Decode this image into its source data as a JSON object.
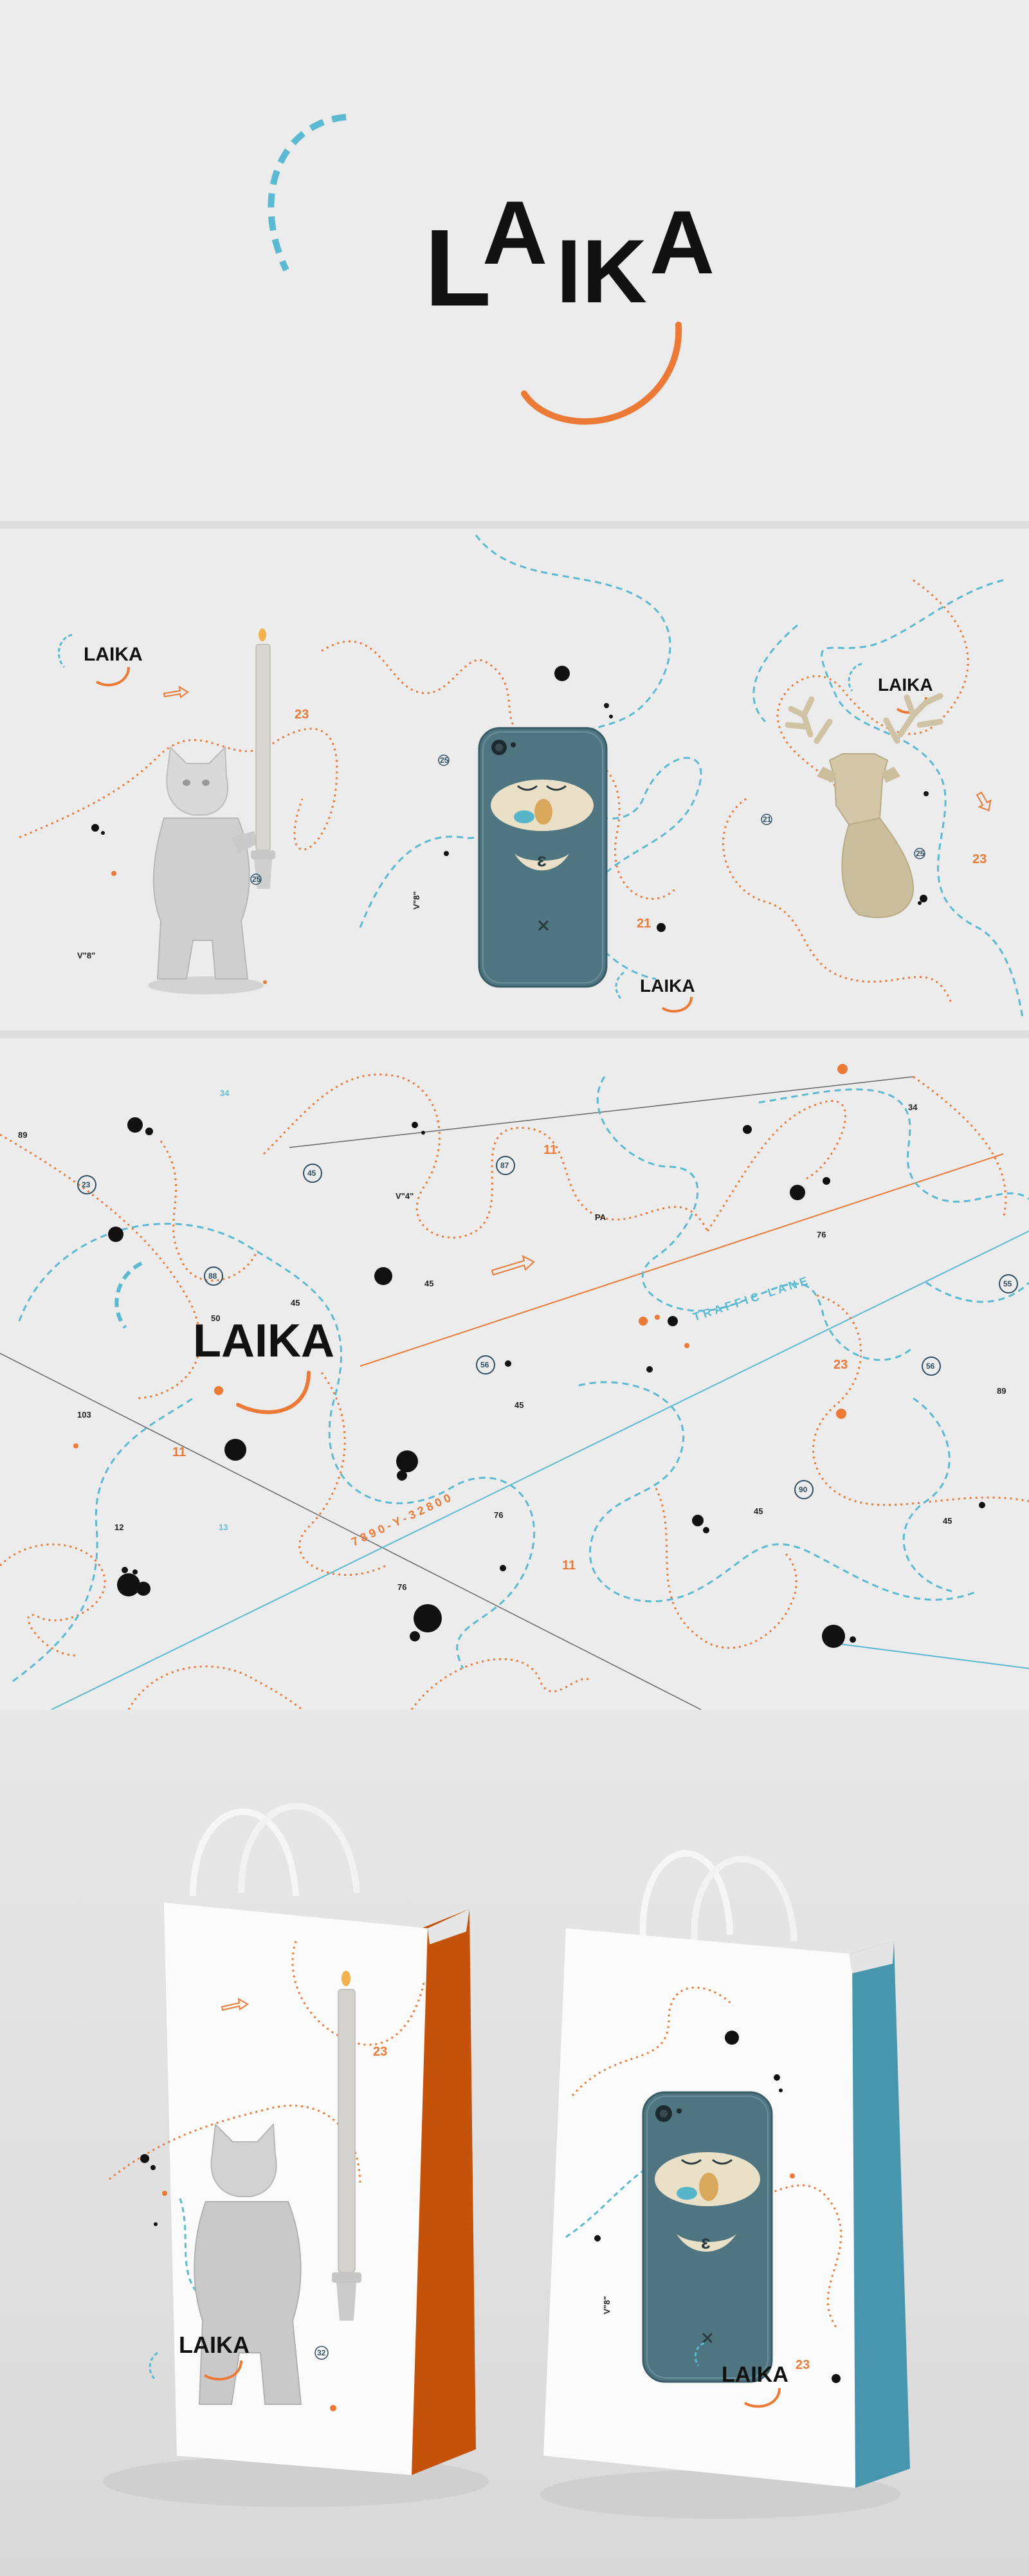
{
  "brand": {
    "logo_text": "LAIKA",
    "logo_parts": [
      "L",
      "A",
      "I",
      "K",
      "A"
    ],
    "colors": {
      "orange": "#ec7a36",
      "blue": "#5bbad2",
      "black": "#111111",
      "phone": "#4e7580",
      "bag_orange": "#c4520a",
      "bag_blue": "#4796ad"
    }
  },
  "panel_showcase": {
    "numbers": [
      "23",
      "25",
      "25",
      "21",
      "23",
      "21",
      "25"
    ],
    "labels": [
      "V\"8\"",
      "V\"8\""
    ]
  },
  "pattern_panel": {
    "numbers": [
      "89",
      "34",
      "23",
      "45",
      "87",
      "11",
      "V\"4\"",
      "PA",
      "34",
      "76",
      "88",
      "45",
      "50",
      "45",
      "55",
      "23",
      "56",
      "56",
      "89",
      "103",
      "45",
      "11",
      "90",
      "12",
      "13",
      "76",
      "45",
      "45",
      "11"
    ],
    "road_labels": [
      "TRAFFIC LANE",
      "7890-Y-32800"
    ]
  },
  "bags": {
    "left_numbers": [
      "23",
      "32"
    ],
    "right_numbers": [
      "23"
    ],
    "labels": [
      "V\"8\""
    ]
  },
  "icons": [
    "arrow-right-icon",
    "arrow-up-icon",
    "close-x-icon",
    "camera-lens-icon"
  ]
}
